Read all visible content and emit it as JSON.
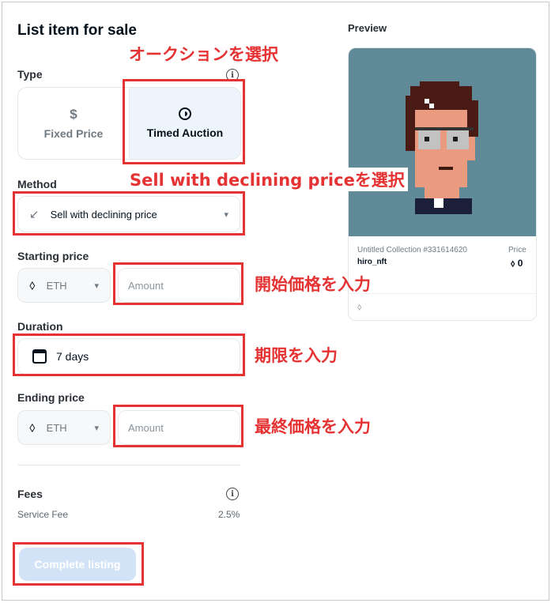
{
  "header": {
    "title": "List item for sale"
  },
  "type_section": {
    "label": "Type",
    "options": [
      {
        "label": "Fixed Price",
        "icon": "dollar-icon"
      },
      {
        "label": "Timed Auction",
        "icon": "clock-icon"
      }
    ],
    "selected": "Timed Auction"
  },
  "method_section": {
    "label": "Method",
    "value": "Sell with declining price",
    "icon": "arrow-down-left-icon"
  },
  "starting_price": {
    "label": "Starting price",
    "currency": "ETH",
    "placeholder": "Amount"
  },
  "duration": {
    "label": "Duration",
    "value": "7 days"
  },
  "ending_price": {
    "label": "Ending price",
    "currency": "ETH",
    "placeholder": "Amount"
  },
  "fees": {
    "label": "Fees",
    "service_fee_label": "Service Fee",
    "service_fee_value": "2.5%"
  },
  "actions": {
    "complete_label": "Complete listing"
  },
  "preview": {
    "label": "Preview",
    "collection": "Untitled Collection #331614620",
    "owner": "hiro_nft",
    "price_label": "Price",
    "price_value": "0"
  },
  "annotations": {
    "type_note": "オークションを選択",
    "method_note": "Sell with declining priceを選択",
    "starting_note": "開始価格を入力",
    "duration_note": "期限を入力",
    "ending_note": "最終価格を入力"
  },
  "colors": {
    "annotation_red": "#e53232",
    "preview_bg": "#618a98",
    "button_disabled": "#d3e3f7"
  }
}
